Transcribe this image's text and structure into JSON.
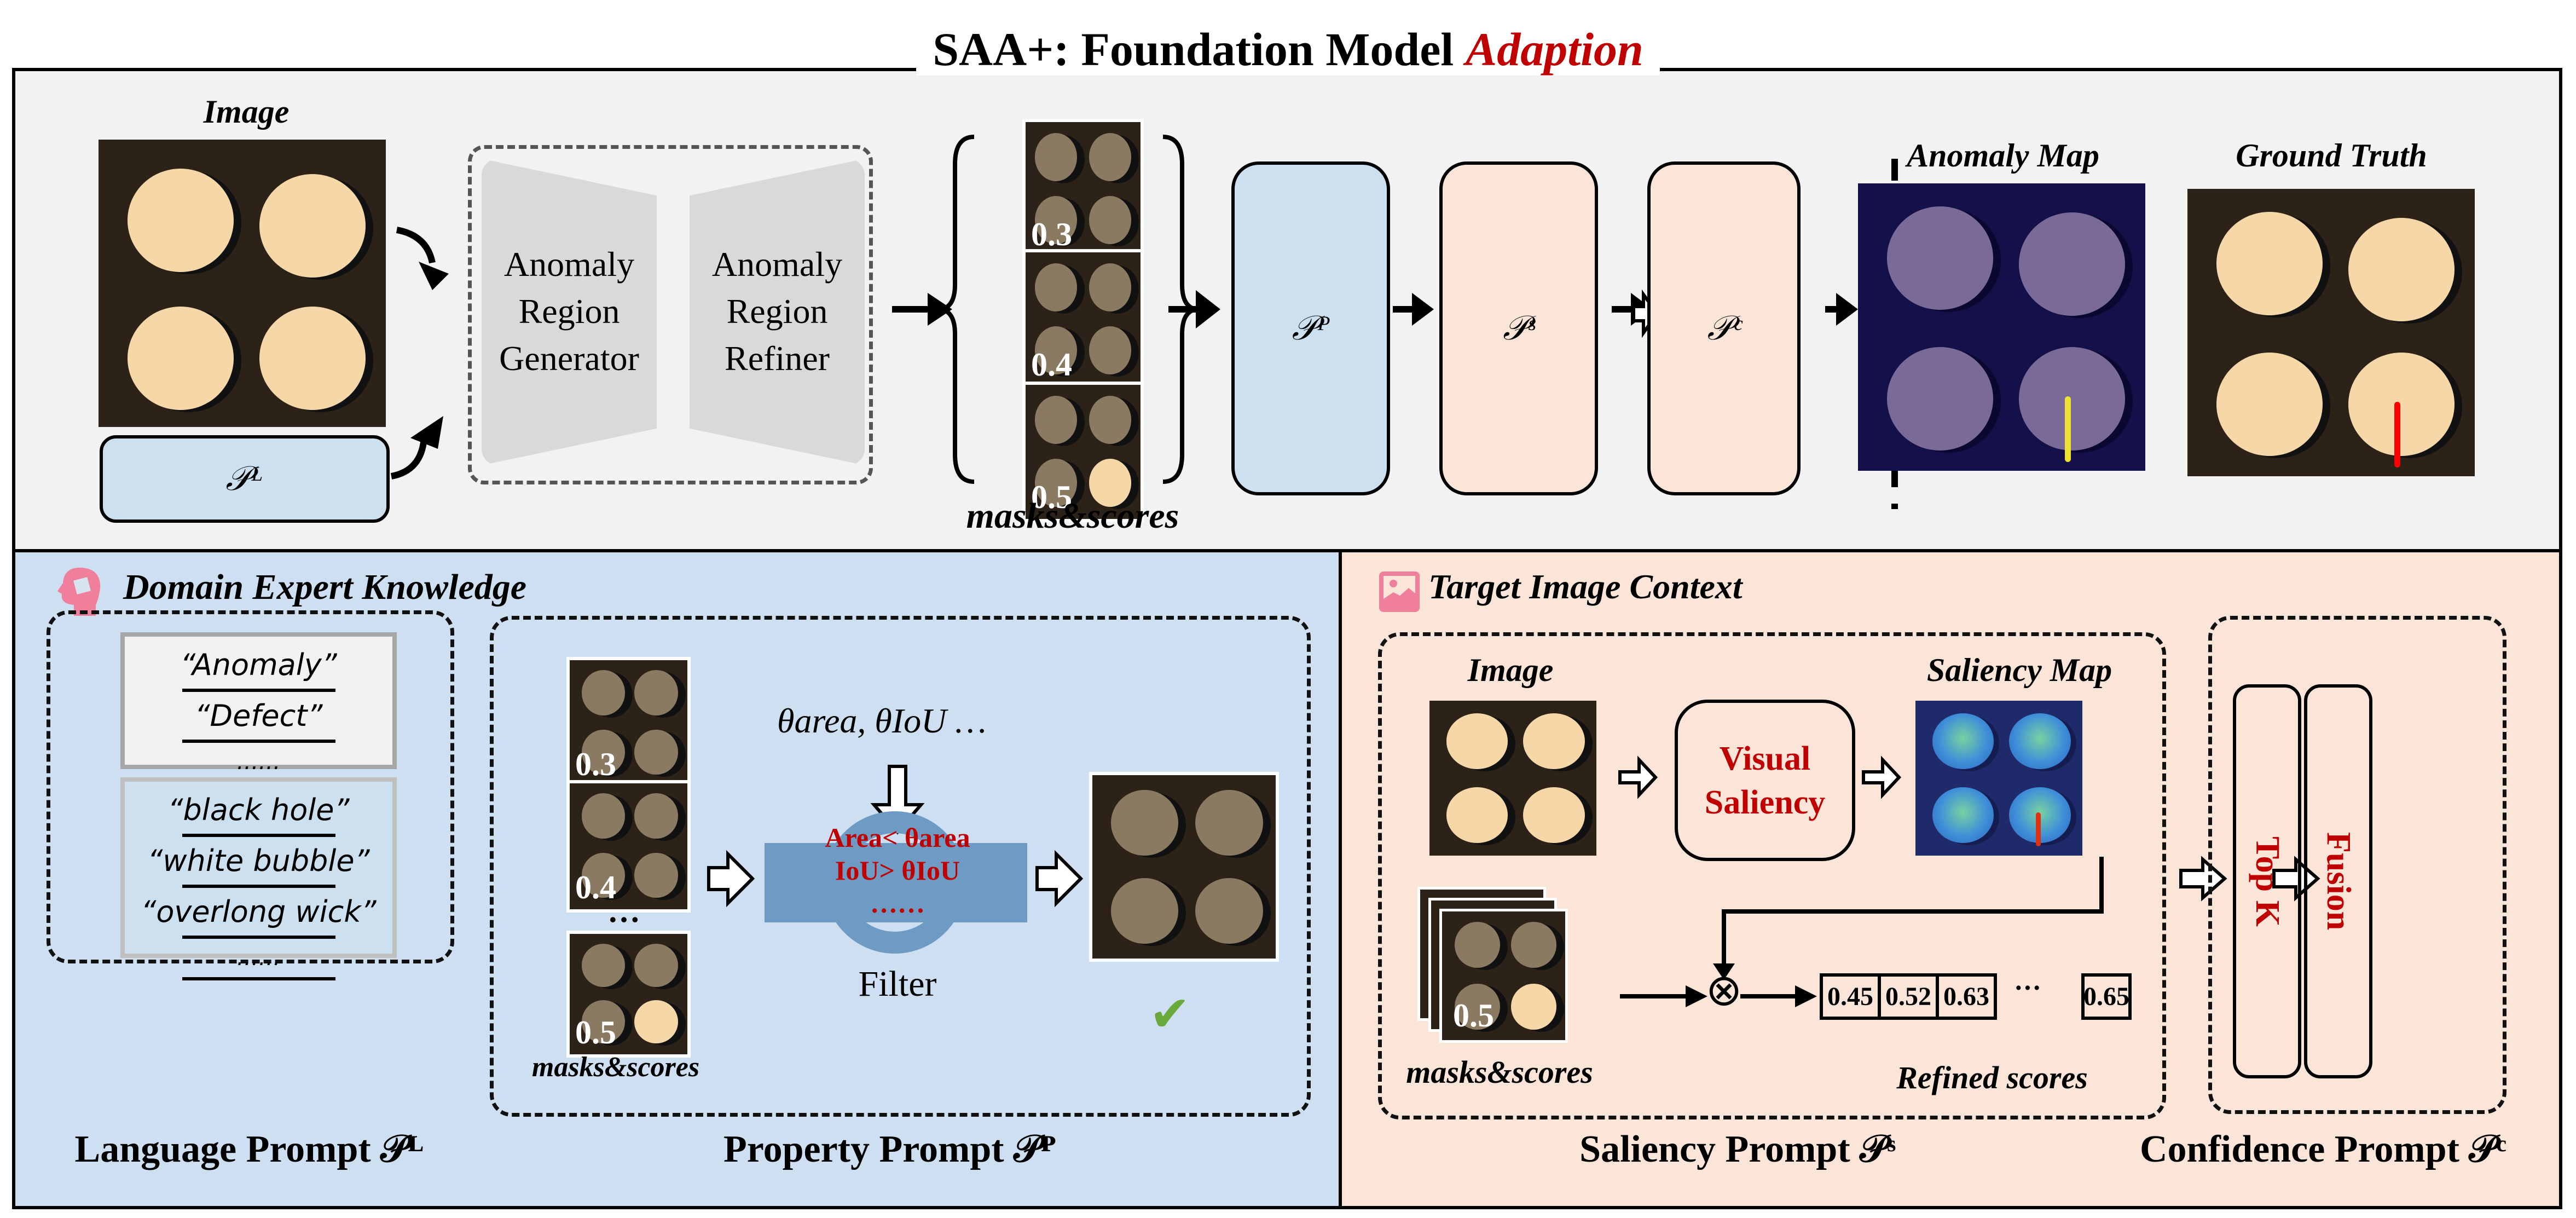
{
  "title": {
    "prefix": "SAA+: Foundation Model ",
    "highlight": "Adaption"
  },
  "top": {
    "image_label": "Image",
    "language_prompt_symbol": "𝒫ᴸ",
    "generator_label": [
      "Anomaly",
      "Region",
      "Generator"
    ],
    "refiner_label": [
      "Anomaly",
      "Region",
      "Refiner"
    ],
    "mask_scores": [
      "0.3",
      "0.4",
      "0.5"
    ],
    "masks_label": "masks&scores",
    "property_prompt_symbol": "𝒫ᴾ",
    "saliency_prompt_symbol": "𝒫ˢ",
    "confidence_prompt_symbol": "𝒫ᶜ",
    "anomaly_map_label": "Anomaly Map",
    "ground_truth_label": "Ground Truth"
  },
  "domain_expert": {
    "heading": "Domain Expert Knowledge",
    "generic_terms": [
      "“Anomaly”",
      "“Defect”",
      "……"
    ],
    "specific_terms": [
      "“black hole”",
      "“white bubble”",
      "“overlong wick”",
      "……"
    ],
    "language_caption": "Language Prompt 𝒫ᴸ",
    "thresholds": "θarea, θIoU …",
    "filter_rules": [
      "Area< θarea",
      "IoU> θIoU",
      "……"
    ],
    "filter_label": "Filter",
    "mask_scores": [
      "0.3",
      "0.4",
      "0.5"
    ],
    "ellipsis": "…",
    "masks_label": "masks&scores",
    "property_caption": "Property Prompt 𝒫ᴾ",
    "check_icon": "✔"
  },
  "target_context": {
    "heading": "Target Image Context",
    "image_label": "Image",
    "visual_saliency": [
      "Visual",
      "Saliency"
    ],
    "saliency_map_label": "Saliency Map",
    "mask_score": "0.5",
    "masks_label": "masks&scores",
    "multiply_symbol": "⊗",
    "refined_scores": [
      "0.45",
      "0.52",
      "0.63"
    ],
    "refined_ellipsis": "···",
    "refined_last": "0.65",
    "refined_label": "Refined scores",
    "saliency_caption": "Saliency Prompt 𝒫ˢ",
    "top_k": "Top K",
    "fusion": "Fusion",
    "confidence_caption": "Confidence Prompt 𝒫ᶜ"
  },
  "colors": {
    "accent_red": "#c00000",
    "blue_panel": "#cddff0",
    "peach_panel": "#fbe5d8",
    "icon_pink": "#f07f9c",
    "check_green": "#6aaa3c"
  }
}
